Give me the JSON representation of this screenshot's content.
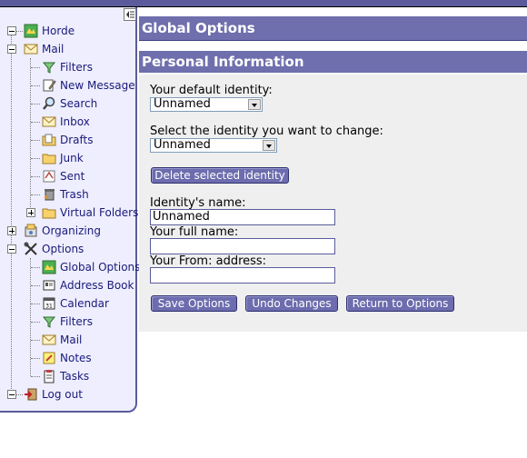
{
  "sidebar": {
    "items": {
      "horde": "Horde",
      "mail": "Mail",
      "filters": "Filters",
      "new_message": "New Message",
      "search": "Search",
      "inbox": "Inbox",
      "drafts": "Drafts",
      "junk": "Junk",
      "sent": "Sent",
      "trash": "Trash",
      "virtual_folders": "Virtual Folders",
      "organizing": "Organizing",
      "options": "Options",
      "global_options": "Global Options",
      "address_book": "Address Book",
      "calendar": "Calendar",
      "opt_filters": "Filters",
      "opt_mail": "Mail",
      "notes": "Notes",
      "tasks": "Tasks",
      "logout": "Log out"
    }
  },
  "main": {
    "title": "Global Options",
    "section_title": "Personal Information",
    "default_identity_label": "Your default identity:",
    "default_identity_value": "Unnamed",
    "change_identity_label": "Select the identity you want to change:",
    "change_identity_value": "Unnamed",
    "delete_button": "Delete selected identity",
    "identity_name_label": "Identity's name:",
    "identity_name_value": "Unnamed",
    "full_name_label": "Your full name:",
    "full_name_value": "",
    "from_address_label": "Your From: address:",
    "from_address_value": "",
    "save_button": "Save Options",
    "undo_button": "Undo Changes",
    "return_button": "Return to Options"
  },
  "colors": {
    "header": "#6f6fae",
    "sidebar_bg": "#eeeeff",
    "button": "#6c6cae",
    "link": "#1a1a7a"
  }
}
